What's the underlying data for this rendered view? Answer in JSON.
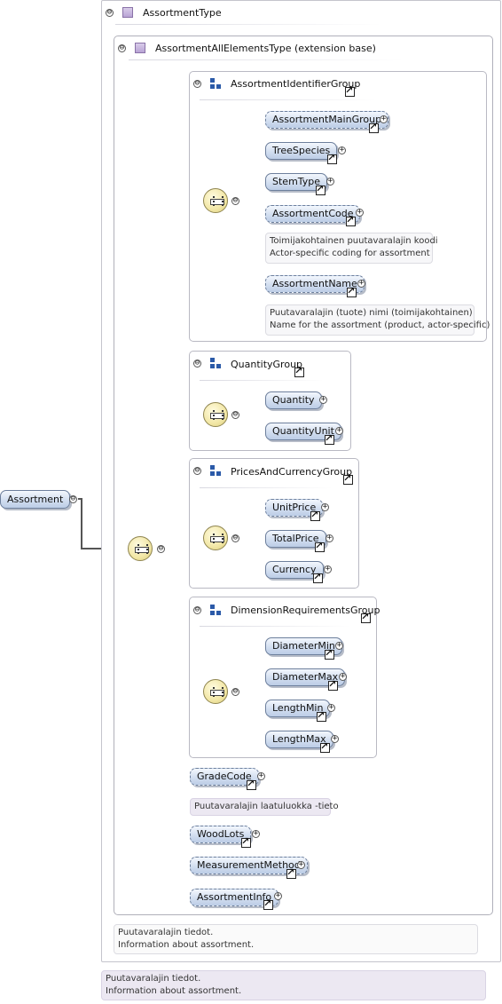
{
  "root": {
    "label": "Assortment",
    "annotation": [
      "Puutavaralajin tiedot.",
      "Information about assortment."
    ]
  },
  "complex_type": {
    "title": "AssortmentType",
    "annotation": [
      "Puutavaralajin tiedot.",
      "Information about assortment."
    ]
  },
  "base_type": {
    "title": "AssortmentAllElementsType (extension base)"
  },
  "groups": {
    "identifier": {
      "title": "AssortmentIdentifierGroup",
      "elements": [
        "AssortmentMainGroup",
        "TreeSpecies",
        "StemType",
        "AssortmentCode",
        "AssortmentName"
      ],
      "code_annotation": [
        "Toimijakohtainen puutavaralajin koodi",
        "Actor-specific coding for assortment"
      ],
      "name_annotation": [
        "Puutavaralajin (tuote) nimi (toimijakohtainen)",
        "Name for the assortment (product, actor-specific)"
      ]
    },
    "quantity": {
      "title": "QuantityGroup",
      "elements": [
        "Quantity",
        "QuantityUnit"
      ]
    },
    "prices": {
      "title": "PricesAndCurrencyGroup",
      "elements": [
        "UnitPrice",
        "TotalPrice",
        "Currency"
      ]
    },
    "dimension": {
      "title": "DimensionRequirementsGroup",
      "elements": [
        "DiameterMin",
        "DiameterMax",
        "LengthMin",
        "LengthMax"
      ]
    }
  },
  "elements": {
    "grade_code": "GradeCode",
    "grade_code_annotation": "Puutavaralajin laatuluokka -tieto",
    "wood_lots": "WoodLots",
    "measurement_method": "MeasurementMethod",
    "assortment_info": "AssortmentInfo"
  },
  "symbols": {
    "collapse": "⊖",
    "expand": "+"
  }
}
